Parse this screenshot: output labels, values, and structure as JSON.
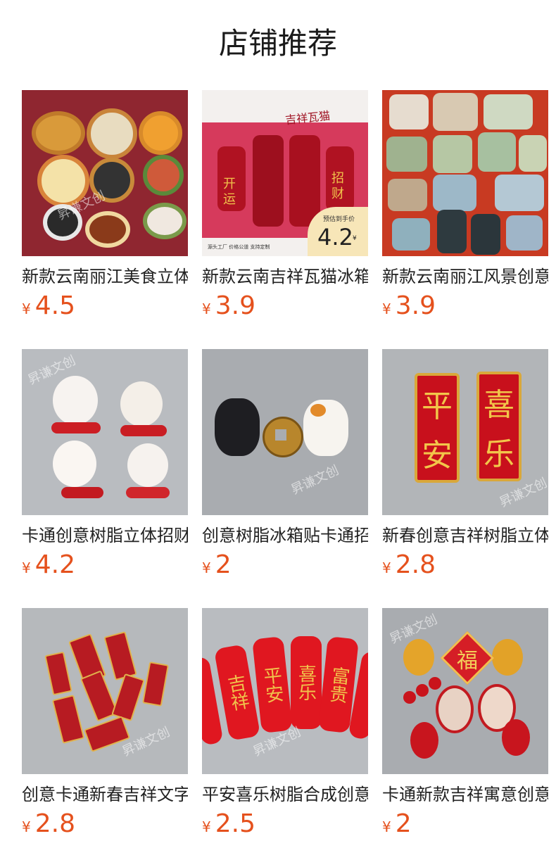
{
  "page": {
    "title": "店铺推荐"
  },
  "currency": "¥",
  "products": [
    {
      "title": "新款云南丽江美食立体冰箱贴",
      "price": "4.5",
      "image": "yunnan-food-magnets"
    },
    {
      "title": "新款云南吉祥瓦猫冰箱贴",
      "price": "3.9",
      "image": "wamao-cat-magnets",
      "image_text": {
        "heading": "吉祥瓦猫",
        "badge_label": "预估到手价",
        "badge_price": "4.2",
        "badge_unit": "¥",
        "footer": "源头工厂 价格公道 支持定制",
        "chars": [
          "开",
          "运",
          "招",
          "财"
        ]
      }
    },
    {
      "title": "新款云南丽江风景创意冰箱贴",
      "price": "3.9",
      "image": "lijiang-scenery-magnets"
    },
    {
      "title": "卡通创意树脂立体招财猫",
      "price": "4.2",
      "image": "lucky-cat-magnets"
    },
    {
      "title": "创意树脂冰箱贴卡通招财猫",
      "price": "2",
      "image": "black-cat-coin-magnets"
    },
    {
      "title": "新春创意吉祥树脂立体冰箱贴",
      "price": "2.8",
      "image": "pingan-xile-plaques",
      "image_text": {
        "left": [
          "平",
          "安"
        ],
        "right": [
          "喜",
          "乐"
        ]
      }
    },
    {
      "title": "创意卡通新春吉祥文字冰箱贴",
      "price": "2.8",
      "image": "small-red-text-tags"
    },
    {
      "title": "平安喜乐树脂合成创意冰箱贴",
      "price": "2.5",
      "image": "red-blessing-bars",
      "image_text": {
        "bars": [
          "吉祥",
          "平安",
          "喜乐",
          "富贵"
        ]
      }
    },
    {
      "title": "卡通新款吉祥寓意创意冰箱贴",
      "price": "2",
      "image": "gourd-fu-magnets",
      "image_text": {
        "fu": "福"
      }
    }
  ],
  "watermark": "昇谦文创",
  "colors": {
    "price": "#e5511d",
    "title": "#222222"
  }
}
